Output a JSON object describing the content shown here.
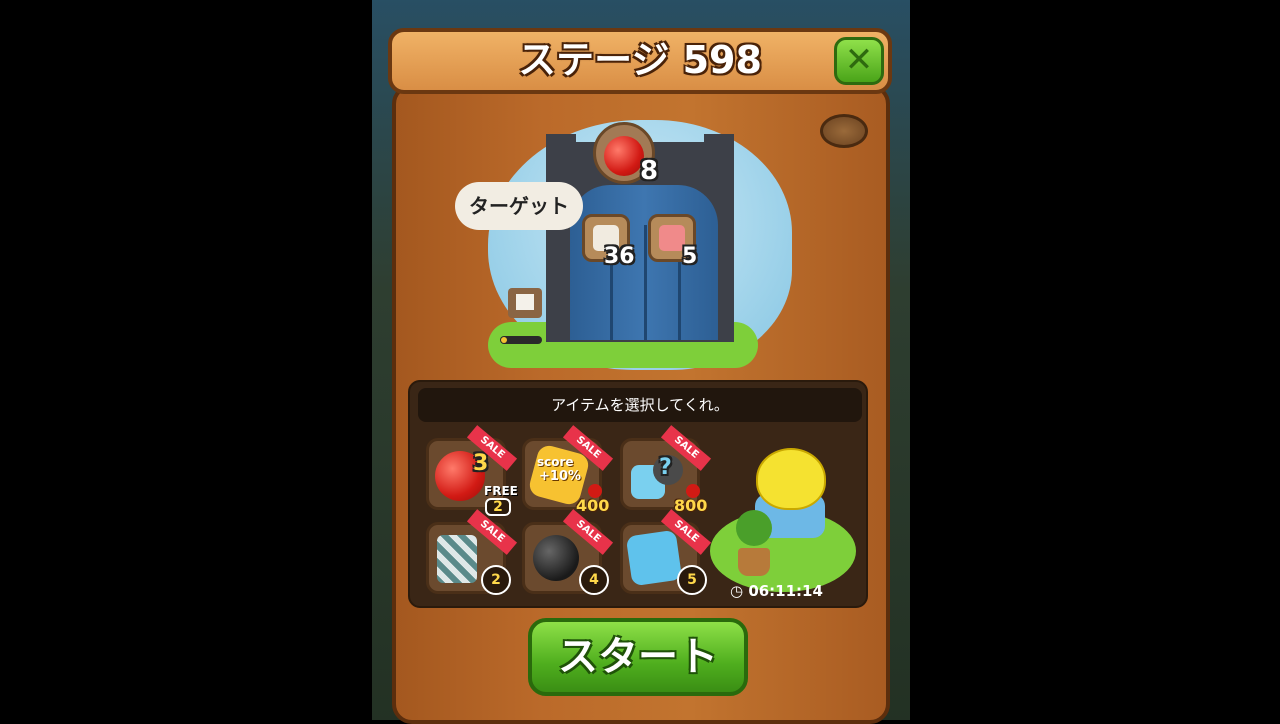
{
  "header": {
    "title": "ステージ 598"
  },
  "target": {
    "bubble_label": "ターゲット",
    "apple_count": "8",
    "cracker_count": "36",
    "jelly_count": "5"
  },
  "items": {
    "prompt": "アイテムを選択してくれ。",
    "sale_label": "SALE",
    "slots": [
      {
        "id": "apple-3",
        "number": "3",
        "free_label": "FREE",
        "count": "2"
      },
      {
        "id": "score-plus",
        "score_label": "score",
        "bonus_label": "+10%",
        "price": "400"
      },
      {
        "id": "mystery",
        "price": "800"
      },
      {
        "id": "cannon",
        "count": "2"
      },
      {
        "id": "bomb",
        "count": "4"
      },
      {
        "id": "cookie-box",
        "count": "5"
      }
    ],
    "timer": "06:11:14"
  },
  "start": {
    "label": "スタート"
  },
  "colors": {
    "accent_green": "#4fae1e",
    "sale_red": "#e8334a",
    "panel_brown": "#bb6a2a"
  }
}
